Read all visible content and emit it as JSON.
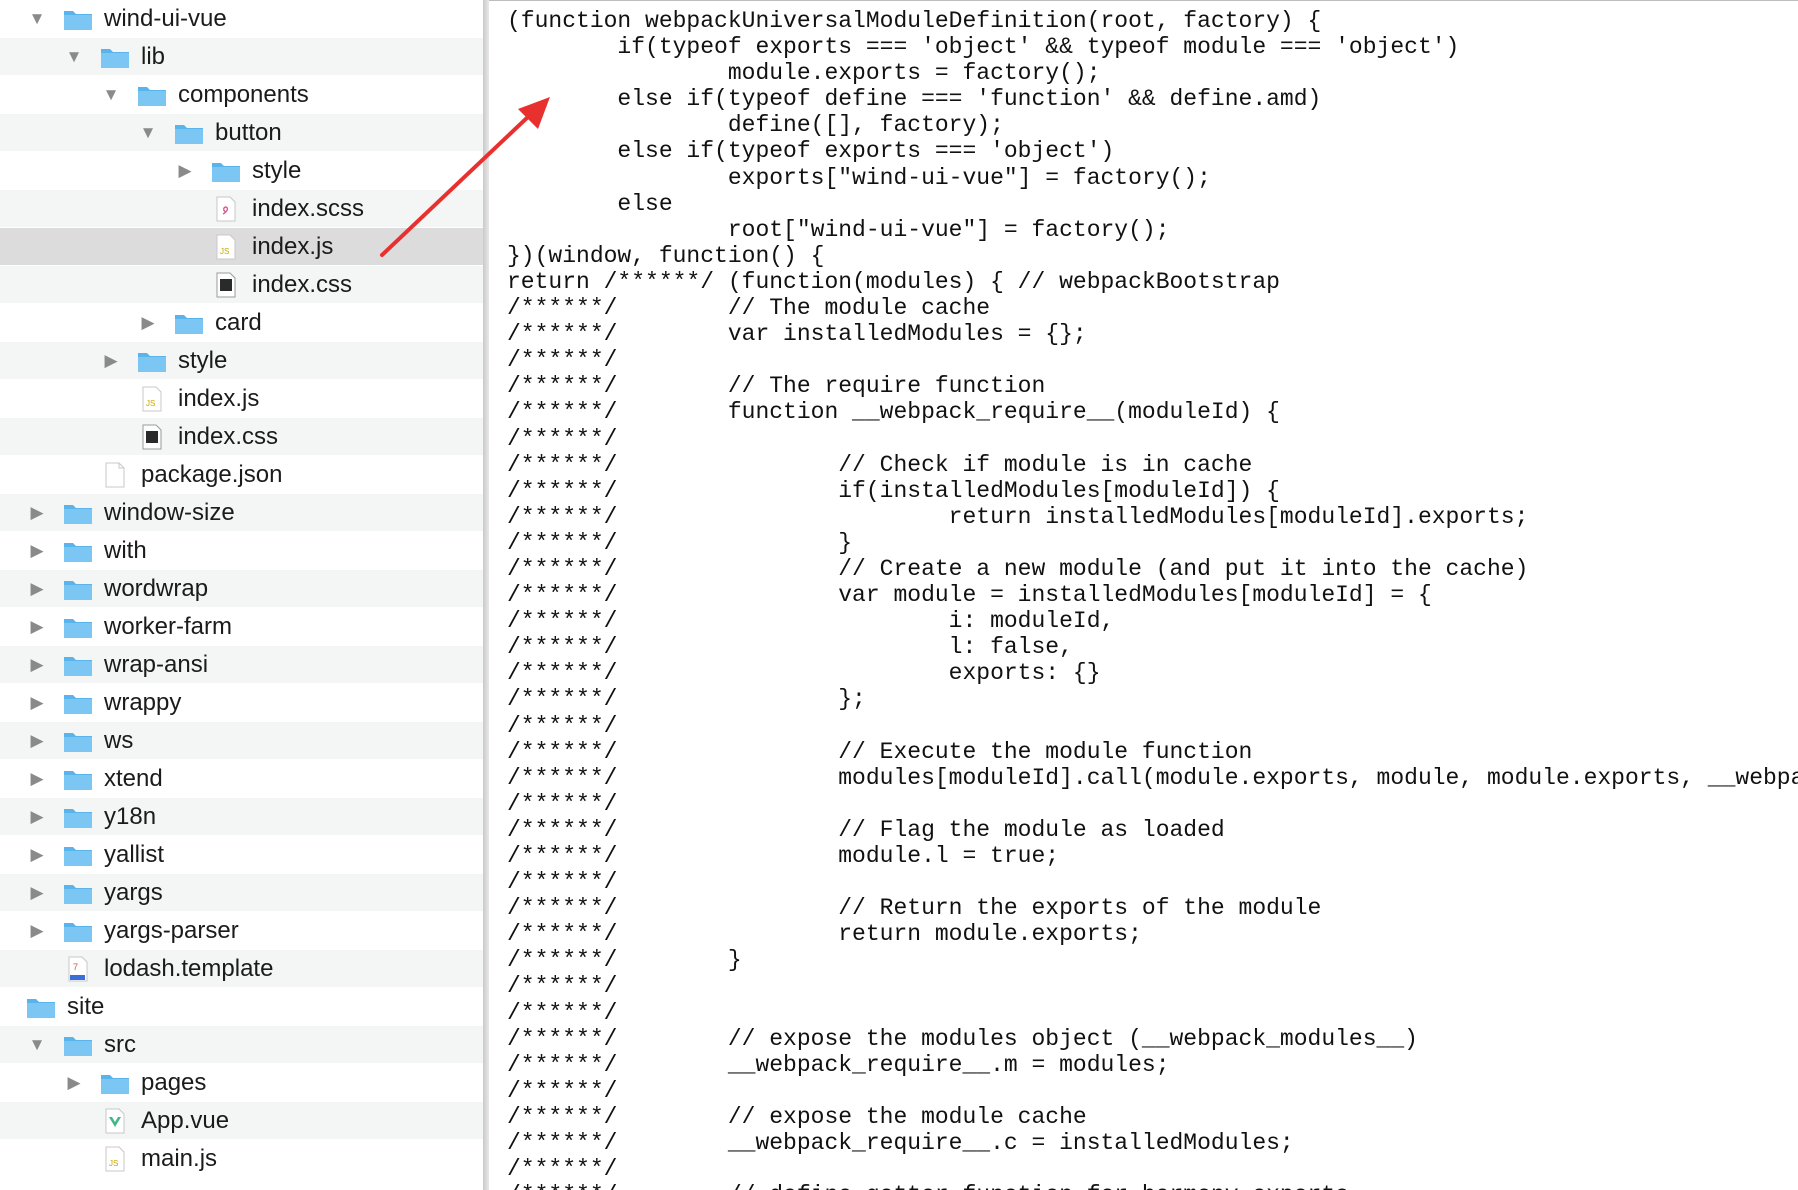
{
  "finder": {
    "rows": [
      {
        "label": "wind-ui-vue",
        "indent": 0,
        "disclosure": "open",
        "icon": "folder-icon"
      },
      {
        "label": "lib",
        "indent": 1,
        "disclosure": "open",
        "icon": "folder-icon"
      },
      {
        "label": "components",
        "indent": 2,
        "disclosure": "open",
        "icon": "folder-icon"
      },
      {
        "label": "button",
        "indent": 3,
        "disclosure": "open",
        "icon": "folder-icon"
      },
      {
        "label": "style",
        "indent": 4,
        "disclosure": "closed",
        "icon": "folder-icon"
      },
      {
        "label": "index.scss",
        "indent": 4,
        "disclosure": "none",
        "icon": "scss-file-icon"
      },
      {
        "label": "index.js",
        "indent": 4,
        "disclosure": "none",
        "icon": "js-file-icon",
        "selected": true
      },
      {
        "label": "index.css",
        "indent": 4,
        "disclosure": "none",
        "icon": "css-file-icon"
      },
      {
        "label": "card",
        "indent": 3,
        "disclosure": "closed",
        "icon": "folder-icon"
      },
      {
        "label": "style",
        "indent": 2,
        "disclosure": "closed",
        "icon": "folder-icon"
      },
      {
        "label": "index.js",
        "indent": 2,
        "disclosure": "none",
        "icon": "js-file-icon"
      },
      {
        "label": "index.css",
        "indent": 2,
        "disclosure": "none",
        "icon": "css-file-icon"
      },
      {
        "label": "package.json",
        "indent": 1,
        "disclosure": "none",
        "icon": "blank-file-icon"
      },
      {
        "label": "window-size",
        "indent": 0,
        "disclosure": "closed",
        "icon": "folder-icon"
      },
      {
        "label": "with",
        "indent": 0,
        "disclosure": "closed",
        "icon": "folder-icon"
      },
      {
        "label": "wordwrap",
        "indent": 0,
        "disclosure": "closed",
        "icon": "folder-icon"
      },
      {
        "label": "worker-farm",
        "indent": 0,
        "disclosure": "closed",
        "icon": "folder-icon"
      },
      {
        "label": "wrap-ansi",
        "indent": 0,
        "disclosure": "closed",
        "icon": "folder-icon"
      },
      {
        "label": "wrappy",
        "indent": 0,
        "disclosure": "closed",
        "icon": "folder-icon"
      },
      {
        "label": "ws",
        "indent": 0,
        "disclosure": "closed",
        "icon": "folder-icon"
      },
      {
        "label": "xtend",
        "indent": 0,
        "disclosure": "closed",
        "icon": "folder-icon"
      },
      {
        "label": "y18n",
        "indent": 0,
        "disclosure": "closed",
        "icon": "folder-icon"
      },
      {
        "label": "yallist",
        "indent": 0,
        "disclosure": "closed",
        "icon": "folder-icon"
      },
      {
        "label": "yargs",
        "indent": 0,
        "disclosure": "closed",
        "icon": "folder-icon"
      },
      {
        "label": "yargs-parser",
        "indent": 0,
        "disclosure": "closed",
        "icon": "folder-icon"
      },
      {
        "label": "lodash.template",
        "indent": 0,
        "disclosure": "none",
        "icon": "template-file-icon"
      },
      {
        "label": "site",
        "indent": -1,
        "disclosure": "none",
        "icon": "folder-icon"
      },
      {
        "label": "src",
        "indent": 0,
        "disclosure": "open",
        "icon": "folder-icon"
      },
      {
        "label": "pages",
        "indent": 1,
        "disclosure": "closed",
        "icon": "folder-icon"
      },
      {
        "label": "App.vue",
        "indent": 1,
        "disclosure": "none",
        "icon": "vue-file-icon"
      },
      {
        "label": "main.js",
        "indent": 1,
        "disclosure": "none",
        "icon": "js-file-icon"
      }
    ]
  },
  "editor": {
    "lines": [
      "(function webpackUniversalModuleDefinition(root, factory) {",
      "        if(typeof exports === 'object' && typeof module === 'object')",
      "                module.exports = factory();",
      "        else if(typeof define === 'function' && define.amd)",
      "                define([], factory);",
      "        else if(typeof exports === 'object')",
      "                exports[\"wind-ui-vue\"] = factory();",
      "        else",
      "                root[\"wind-ui-vue\"] = factory();",
      "})(window, function() {",
      "return /******/ (function(modules) { // webpackBootstrap",
      "/******/        // The module cache",
      "/******/        var installedModules = {};",
      "/******/",
      "/******/        // The require function",
      "/******/        function __webpack_require__(moduleId) {",
      "/******/",
      "/******/                // Check if module is in cache",
      "/******/                if(installedModules[moduleId]) {",
      "/******/                        return installedModules[moduleId].exports;",
      "/******/                }",
      "/******/                // Create a new module (and put it into the cache)",
      "/******/                var module = installedModules[moduleId] = {",
      "/******/                        i: moduleId,",
      "/******/                        l: false,",
      "/******/                        exports: {}",
      "/******/                };",
      "/******/",
      "/******/                // Execute the module function",
      "/******/                modules[moduleId].call(module.exports, module, module.exports, __webpack_r",
      "/******/",
      "/******/                // Flag the module as loaded",
      "/******/                module.l = true;",
      "/******/",
      "/******/                // Return the exports of the module",
      "/******/                return module.exports;",
      "/******/        }",
      "/******/",
      "/******/",
      "/******/        // expose the modules object (__webpack_modules__)",
      "/******/        __webpack_require__.m = modules;",
      "/******/",
      "/******/        // expose the module cache",
      "/******/        __webpack_require__.c = installedModules;",
      "/******/",
      "/******/        // define getter function for harmony exports"
    ]
  },
  "colors": {
    "folder": "#5ab4ec",
    "arrow": "#e8302f",
    "selected_row": "#dcdcdc"
  }
}
